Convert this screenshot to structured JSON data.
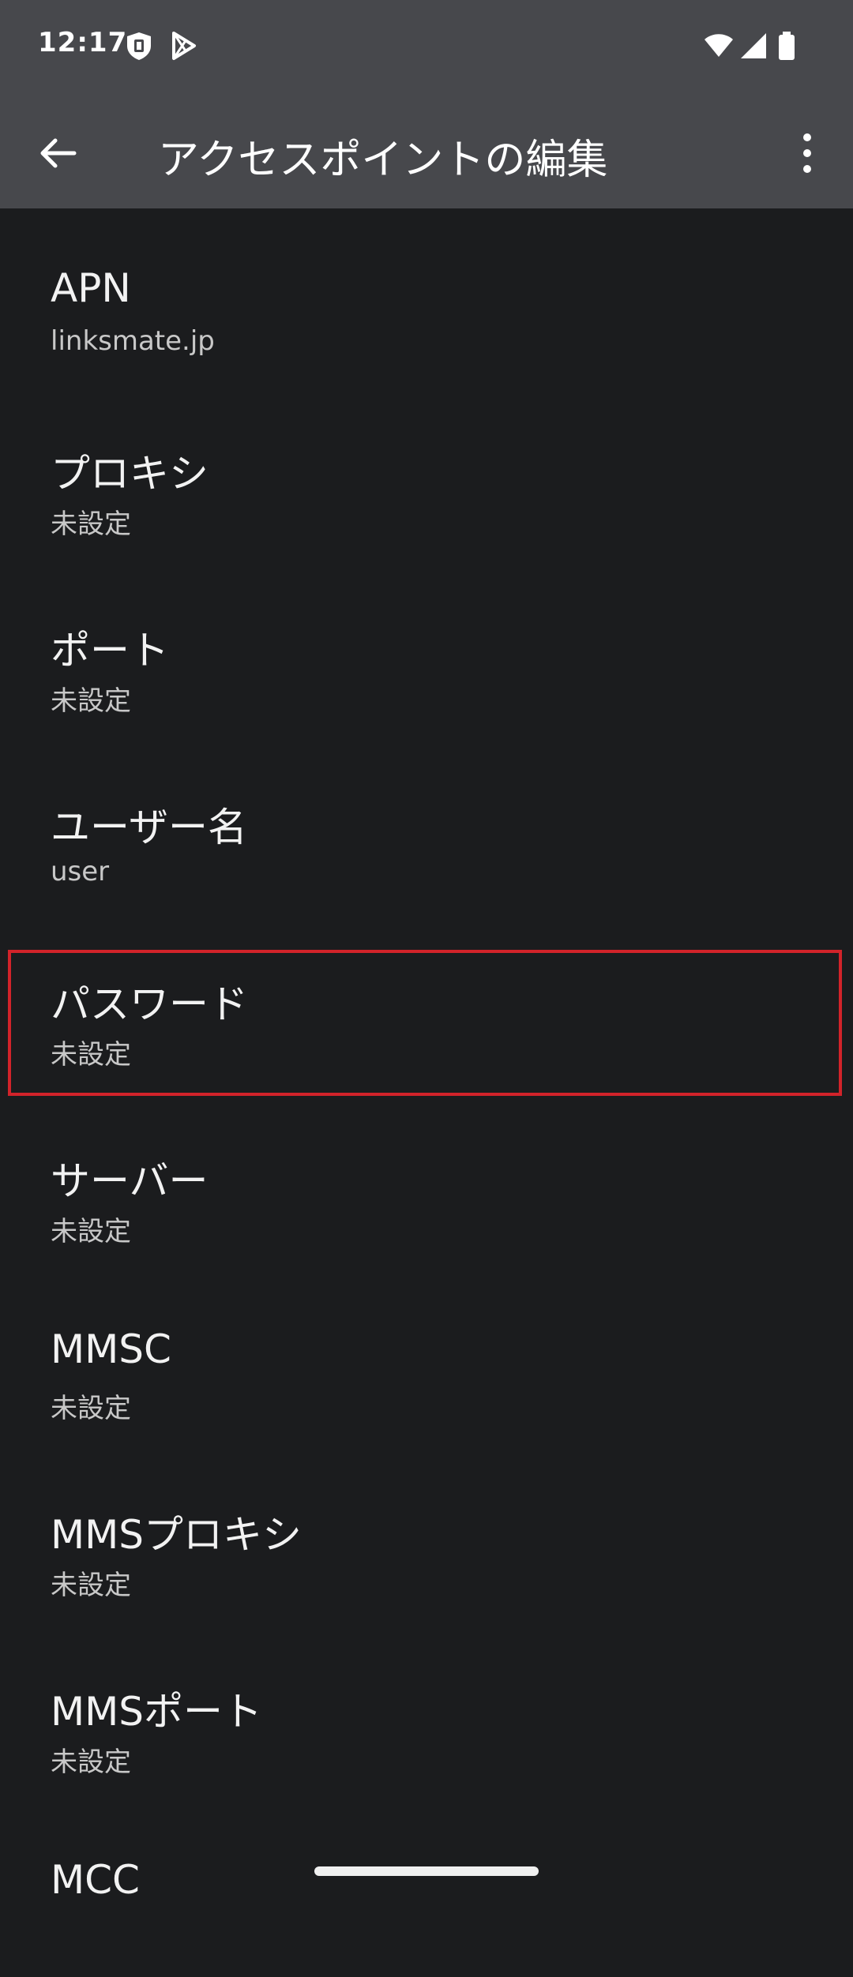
{
  "status_bar": {
    "time": "12:17",
    "left_icons": [
      "shield-notification-icon",
      "play-store-icon"
    ],
    "right_icons": [
      "wifi-icon",
      "cell-signal-icon",
      "battery-icon"
    ]
  },
  "app_bar": {
    "title": "アクセスポイントの編集",
    "back_icon": "arrow-back-icon",
    "menu_icon": "more-vert-icon"
  },
  "settings": [
    {
      "title": "APN",
      "summary": "linksmate.jp"
    },
    {
      "title": "プロキシ",
      "summary": "未設定"
    },
    {
      "title": "ポート",
      "summary": "未設定"
    },
    {
      "title": "ユーザー名",
      "summary": "user"
    },
    {
      "title": "パスワード",
      "summary": "未設定",
      "highlighted": true
    },
    {
      "title": "サーバー",
      "summary": "未設定"
    },
    {
      "title": "MMSC",
      "summary": "未設定"
    },
    {
      "title": "MMSプロキシ",
      "summary": "未設定"
    },
    {
      "title": "MMSポート",
      "summary": "未設定"
    },
    {
      "title": "MCC",
      "summary": ""
    }
  ],
  "colors": {
    "surface": "#47484c",
    "background": "#1b1c1e",
    "highlight": "#d2232a"
  }
}
